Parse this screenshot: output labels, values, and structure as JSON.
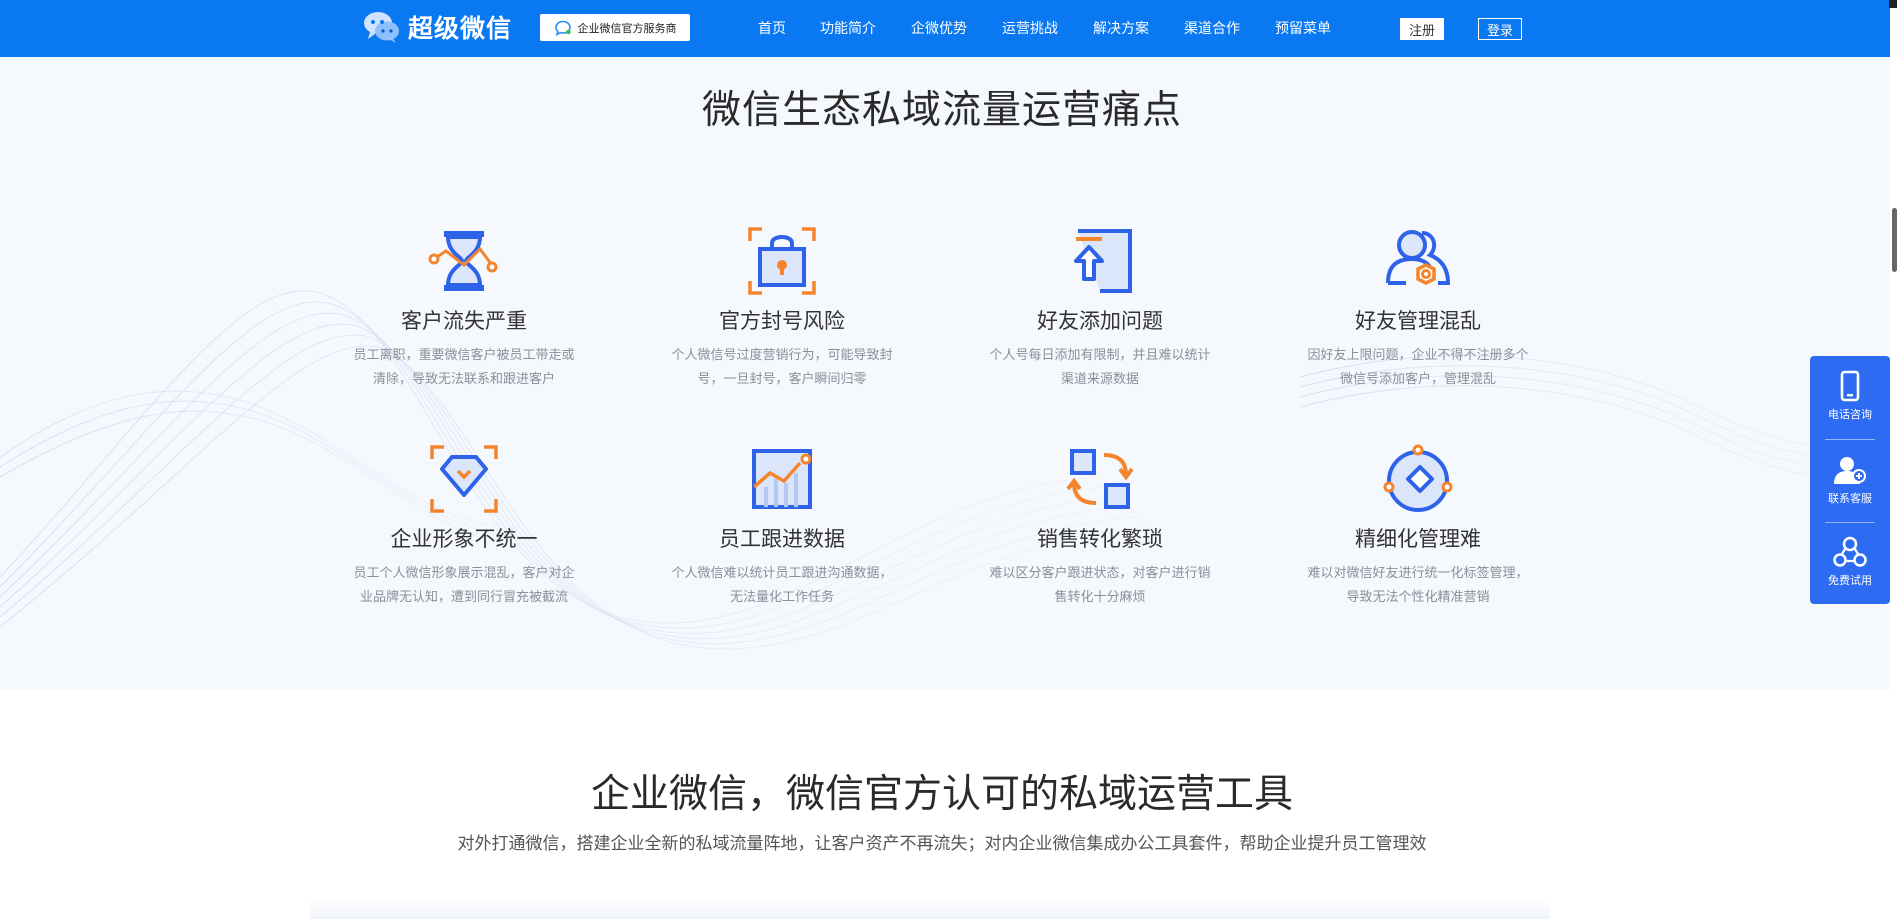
{
  "header": {
    "brand": "超级微信",
    "badge": "企业微信官方服务商",
    "nav": [
      "首页",
      "功能简介",
      "企微优势",
      "运营挑战",
      "解决方案",
      "渠道合作",
      "预留菜单"
    ],
    "register": "注册",
    "login": "登录"
  },
  "pain": {
    "title": "微信生态私域流量运营痛点",
    "items": [
      {
        "name": "客户流失严重",
        "icon": "hourglass-icon",
        "desc": [
          "员工离职，重要微信客户被员工带走或",
          "清除，导致无法联系和跟进客户"
        ]
      },
      {
        "name": "官方封号风险",
        "icon": "lock-icon",
        "desc": [
          "个人微信号过度营销行为，可能导致封",
          "号，一旦封号，客户瞬间归零"
        ]
      },
      {
        "name": "好友添加问题",
        "icon": "add-upload-icon",
        "desc": [
          "个人号每日添加有限制，并且难以统计",
          "渠道来源数据"
        ]
      },
      {
        "name": "好友管理混乱",
        "icon": "users-gear-icon",
        "desc": [
          "因好友上限问题，企业不得不注册多个",
          "微信号添加客户，管理混乱"
        ]
      },
      {
        "name": "企业形象不统一",
        "icon": "diamond-icon",
        "desc": [
          "员工个人微信形象展示混乱，客户对企",
          "业品牌无认知，遭到同行冒充被截流"
        ]
      },
      {
        "name": "员工跟进数据",
        "icon": "chart-icon",
        "desc": [
          "个人微信难以统计员工跟进沟通数据，",
          "无法量化工作任务"
        ]
      },
      {
        "name": "销售转化繁琐",
        "icon": "convert-icon",
        "desc": [
          "难以区分客户跟进状态，对客户进行销",
          "售转化十分麻烦"
        ]
      },
      {
        "name": "精细化管理难",
        "icon": "tag-icon",
        "desc": [
          "难以对微信好友进行统一化标签管理，",
          "导致无法个性化精准营销"
        ]
      }
    ]
  },
  "official": {
    "title": "企业微信，微信官方认可的私域运营工具",
    "subtitle": "对外打通微信，搭建企业全新的私域流量阵地，让客户资产不再流失；对内企业微信集成办公工具套件，帮助企业提升员工管理效"
  },
  "float": {
    "items": [
      "电话咨询",
      "联系客服",
      "免费试用"
    ]
  },
  "colors": {
    "primary": "#0a78f0",
    "accent": "#f5852c",
    "iconBlue": "#2e62e9"
  }
}
